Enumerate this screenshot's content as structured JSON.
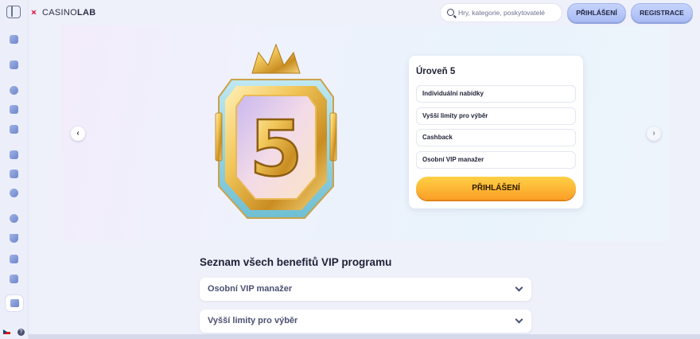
{
  "header": {
    "logo_main": "CASINO",
    "logo_accent": "LAB",
    "search_placeholder": "Hry, kategorie, poskytovatelé",
    "login_label": "PŘIHLÁŠENÍ",
    "register_label": "REGISTRACE"
  },
  "sidebar": {
    "icons": [
      "promo-icon",
      "home-icon",
      "slots-icon",
      "live-casino-icon",
      "card-games-icon",
      "jackpot-icon",
      "table-games-icon",
      "video-poker-icon",
      "roulette-icon",
      "trophy-icon",
      "bonus-icon",
      "vip-icon",
      "crown-icon"
    ],
    "language": "cs",
    "help_label": "?"
  },
  "hero": {
    "level_number": "5",
    "card_title": "Úroveň 5",
    "benefits": [
      "Individuální nabídky",
      "Vyšší limity pro výběr",
      "Cashback",
      "Osobní VIP manažer"
    ],
    "button_label": "PŘIHLÁŠENÍ"
  },
  "benefits_list": {
    "title": "Seznam všech benefitů VIP programu",
    "items": [
      "Osobní VIP manažer",
      "Vyšší limity pro výběr"
    ]
  },
  "colors": {
    "accent_orange": "#fb9f26",
    "accent_blue": "#a9bcf4",
    "gold": "#e8b54a"
  }
}
